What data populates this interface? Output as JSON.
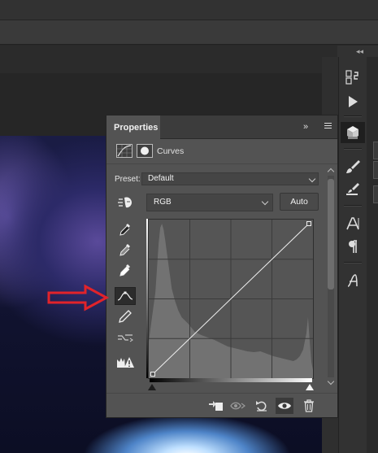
{
  "properties_panel": {
    "tab_title": "Properties",
    "adjustment_type": "Curves",
    "preset_label": "Preset:",
    "preset_value": "Default",
    "channel_value": "RGB",
    "auto_label": "Auto",
    "expand_glyph": "»"
  },
  "curve": {
    "black_point": [
      0,
      0
    ],
    "white_point": [
      255,
      255
    ],
    "input_range": [
      0,
      255
    ],
    "output_range": [
      0,
      255
    ],
    "grid_divisions": 4
  },
  "colors": {
    "annotation_arrow": "#e2232a",
    "panel_bg": "#535353",
    "histogram": "#767676"
  }
}
